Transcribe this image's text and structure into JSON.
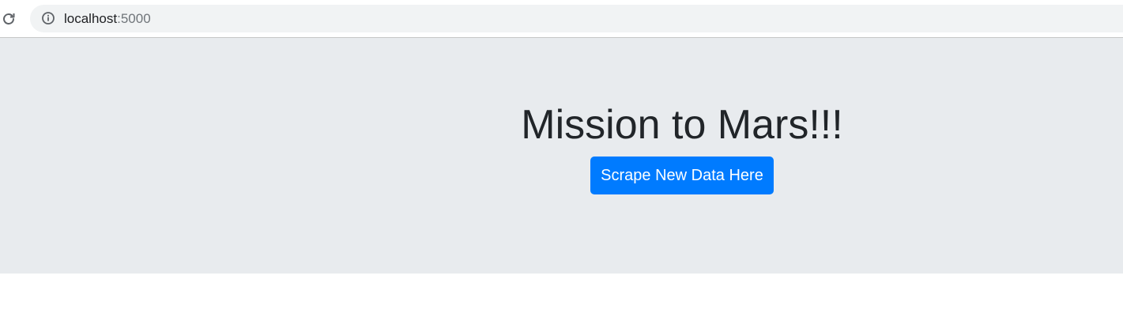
{
  "browser": {
    "url_host": "localhost",
    "url_port": ":5000",
    "reload_icon": "reload-icon",
    "info_icon": "info-icon"
  },
  "page": {
    "title": "Mission to Mars!!!",
    "scrape_button_label": "Scrape New Data Here"
  },
  "colors": {
    "jumbotron_bg": "#e8ebee",
    "button_primary": "#007bff",
    "title_text": "#212529"
  }
}
